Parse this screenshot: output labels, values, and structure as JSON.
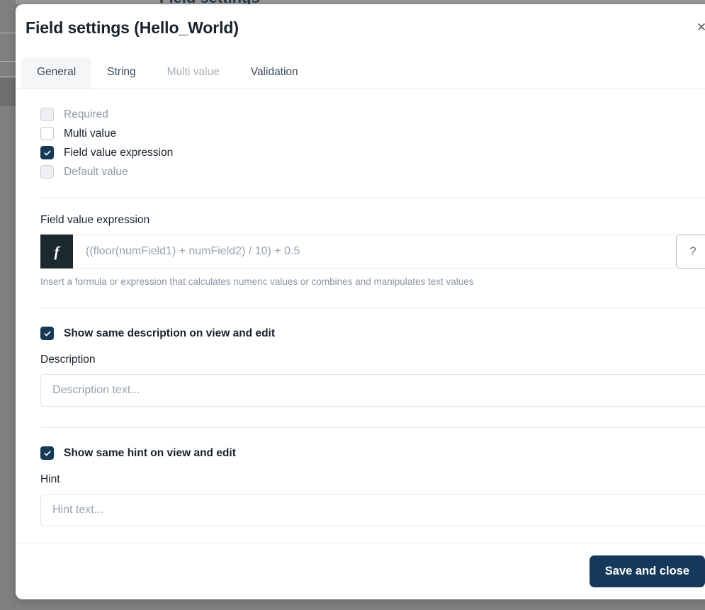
{
  "dialog": {
    "title": "Field settings (Hello_World)",
    "close_icon": "close-icon"
  },
  "tabs": [
    {
      "label": "General",
      "state": "active"
    },
    {
      "label": "String",
      "state": "normal"
    },
    {
      "label": "Multi value",
      "state": "disabled"
    },
    {
      "label": "Validation",
      "state": "normal"
    }
  ],
  "options": [
    {
      "label": "Required",
      "checked": false,
      "disabled": true
    },
    {
      "label": "Multi value",
      "checked": false,
      "disabled": false
    },
    {
      "label": "Field value expression",
      "checked": true,
      "disabled": false
    },
    {
      "label": "Default value",
      "checked": false,
      "disabled": true
    }
  ],
  "expression_section": {
    "label": "Field value expression",
    "fx_icon": "function-icon",
    "fx_glyph": "f",
    "value": "((floor(numField1) + numField2) / 10) + 0.5",
    "placeholder": "",
    "help_button_label": "?",
    "helper_text": "Insert a formula or expression that calculates numeric values or combines and manipulates text values"
  },
  "description_section": {
    "toggle_label": "Show same description on view and edit",
    "toggle_checked": true,
    "field_label": "Description",
    "placeholder": "Description text...",
    "value": ""
  },
  "hint_section": {
    "toggle_label": "Show same hint on view and edit",
    "toggle_checked": true,
    "field_label": "Hint",
    "placeholder": "Hint text...",
    "value": ""
  },
  "footer": {
    "save_label": "Save and close"
  },
  "background": {
    "ghost_title": "Field settings"
  },
  "colors": {
    "accent_dark": "#15395a",
    "fx_badge": "#1b282e",
    "overlay": "#808080",
    "tab_active_bg": "#f5f6f7",
    "muted_text": "#8e99a4",
    "border": "#dfe4e9"
  }
}
